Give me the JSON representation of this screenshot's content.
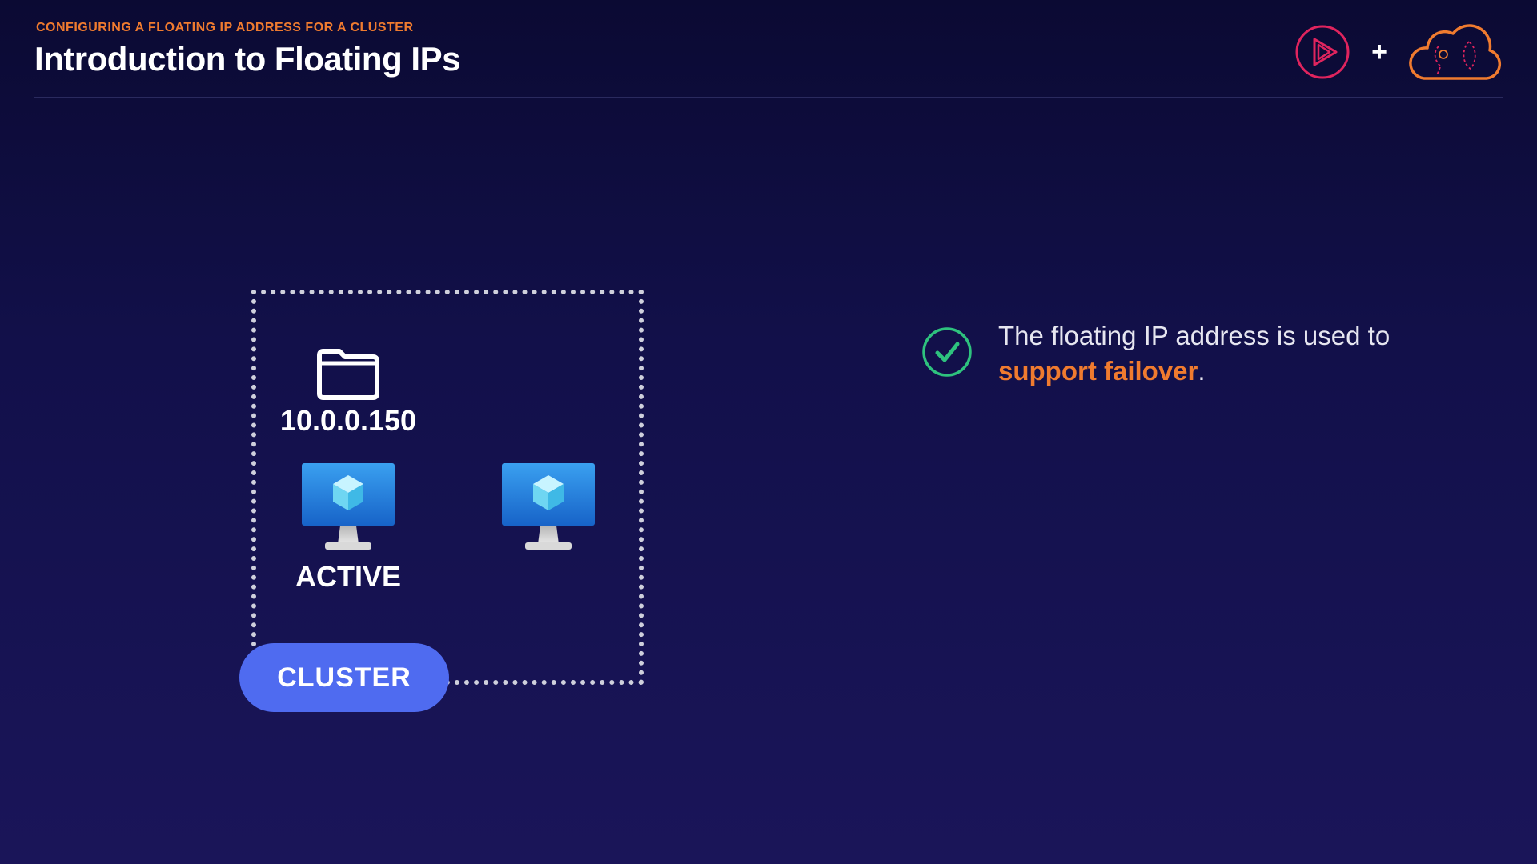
{
  "header": {
    "eyebrow": "CONFIGURING A FLOATING IP ADDRESS FOR A CLUSTER",
    "title": "Introduction to Floating IPs",
    "plus": "+"
  },
  "diagram": {
    "ip_address": "10.0.0.150",
    "active_label": "ACTIVE",
    "cluster_label": "CLUSTER",
    "icons": {
      "folder": "folder-icon",
      "vm": "virtual-machine-icon"
    }
  },
  "statement": {
    "text_before": "The floating IP address is used to ",
    "highlight": "support failover",
    "text_after": "."
  },
  "colors": {
    "accent_orange": "#f07b2f",
    "brand_red": "#e0245e",
    "pill_blue": "#4f6bf0",
    "check_green": "#2ec27e",
    "background_top": "#0b0a33",
    "background_bottom": "#1a1559"
  }
}
